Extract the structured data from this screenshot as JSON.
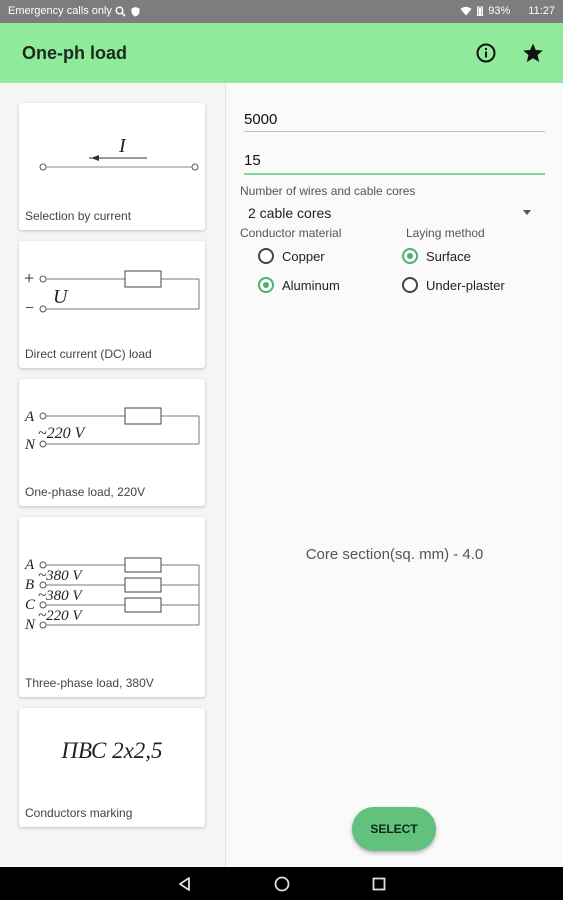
{
  "status_bar": {
    "carrier": "Emergency calls only",
    "battery": "93%",
    "time": "11:27",
    "icons": [
      "search-icon",
      "shield-icon",
      "wifi-icon",
      "battery-icon"
    ]
  },
  "app_bar": {
    "title": "One-ph load",
    "actions": [
      "info-icon",
      "star-icon"
    ]
  },
  "cards": [
    {
      "caption": "Selection by current",
      "diagram": {
        "current_label": "I"
      }
    },
    {
      "caption": "Direct current (DC) load",
      "diagram": {
        "plus": "+",
        "minus": "−",
        "voltage": "U"
      }
    },
    {
      "caption": "One-phase load, 220V",
      "diagram": {
        "a": "A",
        "n": "N",
        "voltage": "~220 V"
      }
    },
    {
      "caption": "Three-phase load, 380V",
      "diagram": {
        "a": "A",
        "b": "B",
        "c": "C",
        "n": "N",
        "v1": "~380 V",
        "v2": "~380 V",
        "v3": "~220 V"
      }
    },
    {
      "caption": "Conductors marking",
      "diagram": {
        "marking": "ПВС 2x2,5"
      }
    }
  ],
  "form": {
    "power_value": "5000",
    "length_value": "15",
    "wires_label": "Number of wires and cable cores",
    "wires_selected": "2 cable cores",
    "material_label": "Conductor material",
    "laying_label": "Laying method",
    "material_options": [
      {
        "label": "Copper",
        "checked": false
      },
      {
        "label": "Aluminum",
        "checked": true
      }
    ],
    "laying_options": [
      {
        "label": "Surface",
        "checked": true
      },
      {
        "label": "Under-plaster",
        "checked": false
      }
    ],
    "result_text": "Core section(sq. mm) - 4.0",
    "select_button": "SELECT"
  },
  "colors": {
    "app_bar": "#90ea9c",
    "accent": "#4caf6f",
    "fab": "#62c17c"
  },
  "nav_bar": [
    "back-icon",
    "home-icon",
    "recents-icon"
  ]
}
